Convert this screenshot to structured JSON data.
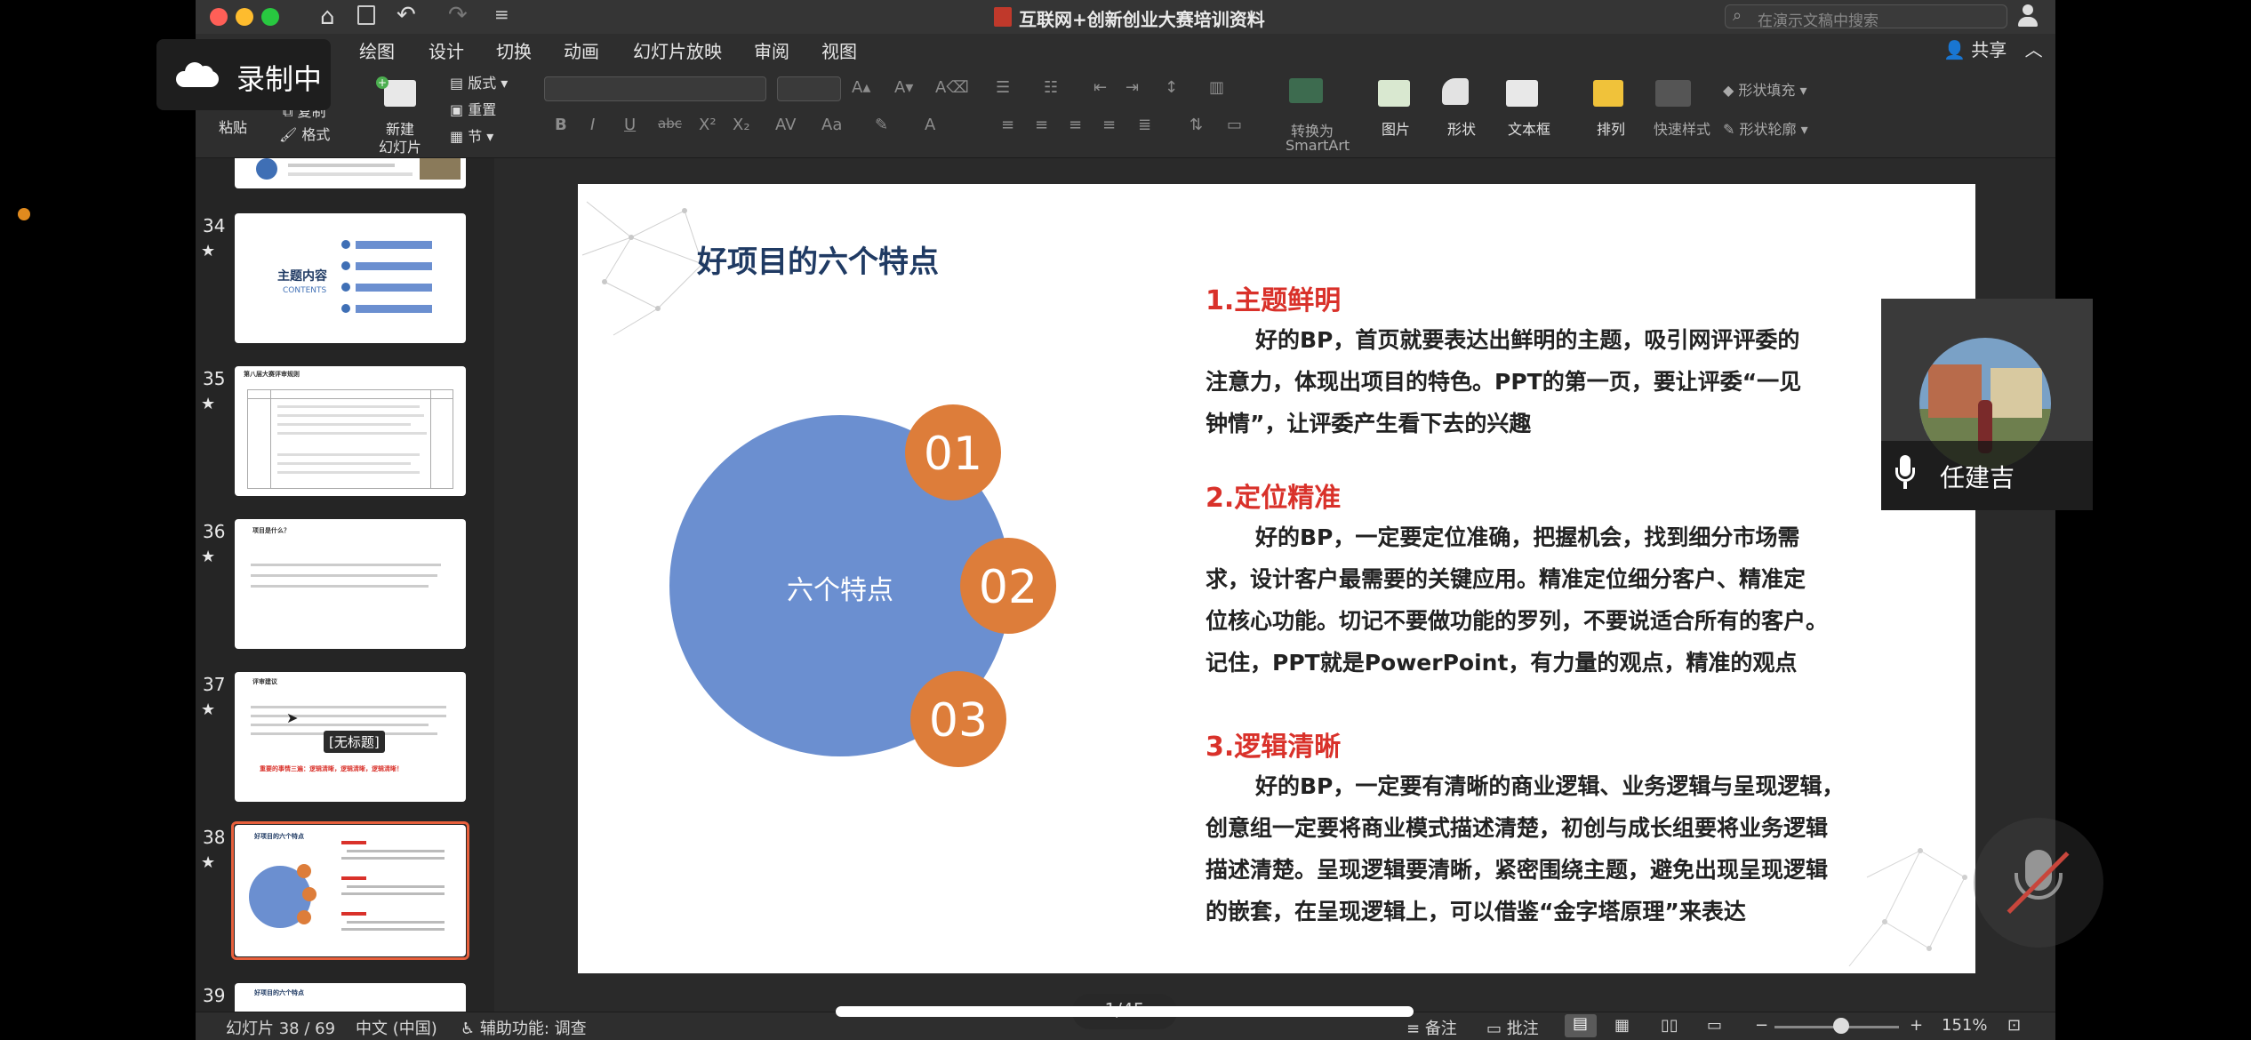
{
  "window": {
    "title": "互联网+创新创业大赛培训资料",
    "search_placeholder": "在演示文稿中搜索"
  },
  "ribbon": {
    "tabs": [
      "绘图",
      "设计",
      "切换",
      "动画",
      "幻灯片放映",
      "审阅",
      "视图"
    ],
    "share_label": "共享",
    "paste_label": "粘贴",
    "copy_label": "复制",
    "format_label": "格式",
    "new_slide_label_1": "新建",
    "new_slide_label_2": "幻灯片",
    "layout_label": "版式",
    "reset_label": "重置",
    "section_label": "节",
    "smartart_label_1": "转换为",
    "smartart_label_2": "SmartArt",
    "picture_label": "图片",
    "shapes_label": "形状",
    "textbox_label": "文本框",
    "arrange_label": "排列",
    "quick_styles_label": "快速样式",
    "shape_fill_label": "形状填充",
    "shape_outline_label": "形状轮廓"
  },
  "recording": {
    "label": "录制中"
  },
  "sidebar": {
    "slides": [
      {
        "number": "34",
        "title": "主题内容",
        "subtitle": "CONTENTS"
      },
      {
        "number": "35",
        "title": "第八届大赛评审规则"
      },
      {
        "number": "36",
        "title": "项目是什么？"
      },
      {
        "number": "37",
        "title": "评审建议",
        "tooltip": "[无标题]",
        "highlight": "重要的事情三遍：逻辑清晰，逻辑清晰，逻辑清晰！"
      },
      {
        "number": "38",
        "title": "好项目的六个特点"
      },
      {
        "number": "39",
        "title": "好项目的六个特点"
      }
    ]
  },
  "slide": {
    "title": "好项目的六个特点",
    "circle_label": "六个特点",
    "badges": [
      "01",
      "02",
      "03"
    ],
    "items": [
      {
        "heading": "1.主题鲜明",
        "lines": [
          "好的BP，首页就要表达出鲜明的主题，吸引网评评委的",
          "注意力，体现出项目的特色。PPT的第一页，要让评委“一见",
          "钟情”，让评委产生看下去的兴趣"
        ]
      },
      {
        "heading": "2.定位精准",
        "lines": [
          "好的BP，一定要定位准确，把握机会，找到细分市场需",
          "求，设计客户最需要的关键应用。精准定位细分客户、精准定",
          "位核心功能。切记不要做功能的罗列，不要说适合所有的客户。",
          "记住，PPT就是PowerPoint，有力量的观点，精准的观点"
        ]
      },
      {
        "heading": "3.逻辑清晰",
        "lines": [
          "好的BP，一定要有清晰的商业逻辑、业务逻辑与呈现逻辑，",
          "创意组一定要将商业模式描述清楚，初创与成长组要将业务逻辑",
          "描述清楚。呈现逻辑要清晰，紧密围绕主题，避免出现呈现逻辑",
          "的嵌套，在呈现逻辑上，可以借鉴“金字塔原理”来表达"
        ]
      }
    ]
  },
  "participant": {
    "name": "任建吉"
  },
  "statusbar": {
    "slide_counter": "幻灯片 38 / 69",
    "language": "中文 (中国)",
    "accessibility": "辅助功能: 调查",
    "notes_label": "备注",
    "comments_label": "批注",
    "zoom": "151%",
    "page_overlay": "1/45"
  },
  "colors": {
    "accent_red": "#d9312a",
    "circle_blue": "#6b8fd0",
    "badge_orange": "#dd7d3a",
    "title_navy": "#1f3a63"
  }
}
